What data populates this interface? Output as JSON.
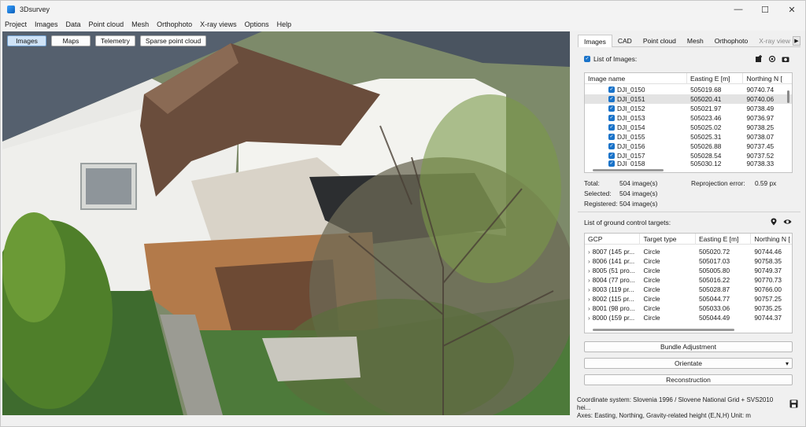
{
  "app": {
    "title": "3Dsurvey"
  },
  "window_controls": {
    "minimize": "—",
    "maximize": "☐",
    "close": "✕"
  },
  "menu": [
    "Project",
    "Images",
    "Data",
    "Point cloud",
    "Mesh",
    "Orthophoto",
    "X-ray views",
    "Options",
    "Help"
  ],
  "view_tabs": [
    {
      "label": "Images",
      "active": true
    },
    {
      "label": "Maps",
      "active": false
    },
    {
      "label": "Telemetry",
      "active": false
    },
    {
      "label": "Sparse point cloud",
      "active": false
    }
  ],
  "panel": {
    "tabs": [
      "Images",
      "CAD",
      "Point cloud",
      "Mesh",
      "Orthophoto",
      "X-ray view"
    ],
    "tab_arrow": "▶",
    "images_list": {
      "label": "List of Images:",
      "icons": [
        "add-image-icon",
        "target-icon",
        "camera-icon"
      ],
      "columns": [
        "Image name",
        "Easting E [m]",
        "Northing N ["
      ],
      "rows": [
        {
          "name": "DJI_0150",
          "easting": "505019.68",
          "northing": "90740.74",
          "selected": false
        },
        {
          "name": "DJI_0151",
          "easting": "505020.41",
          "northing": "90740.06",
          "selected": true
        },
        {
          "name": "DJI_0152",
          "easting": "505021.97",
          "northing": "90738.49",
          "selected": false
        },
        {
          "name": "DJI_0153",
          "easting": "505023.46",
          "northing": "90736.97",
          "selected": false
        },
        {
          "name": "DJI_0154",
          "easting": "505025.02",
          "northing": "90738.25",
          "selected": false
        },
        {
          "name": "DJI_0155",
          "easting": "505025.31",
          "northing": "90738.07",
          "selected": false
        },
        {
          "name": "DJI_0156",
          "easting": "505026.88",
          "northing": "90737.45",
          "selected": false
        },
        {
          "name": "DJI_0157",
          "easting": "505028.54",
          "northing": "90737.52",
          "selected": false
        },
        {
          "name": "DJI_0158",
          "easting": "505030.12",
          "northing": "90738.33",
          "selected": false
        }
      ]
    },
    "stats": {
      "total_label": "Total:",
      "total_value": "504 image(s)",
      "selected_label": "Selected:",
      "selected_value": "504 image(s)",
      "registered_label": "Registered:",
      "registered_value": "504 image(s)",
      "reprojection_label": "Reprojection error:",
      "reprojection_value": "0.59 px"
    },
    "gcp_list": {
      "label": "List of ground control targets:",
      "icons": [
        "map-pin-icon",
        "eye-icon"
      ],
      "columns": [
        "GCP",
        "Target type",
        "Easting E [m]",
        "Northing N ["
      ],
      "rows": [
        {
          "gcp": "8007 (145 pr...",
          "type": "Circle",
          "easting": "505020.72",
          "northing": "90744.46"
        },
        {
          "gcp": "8006 (141 pr...",
          "type": "Circle",
          "easting": "505017.03",
          "northing": "90758.35"
        },
        {
          "gcp": "8005 (51 pro...",
          "type": "Circle",
          "easting": "505005.80",
          "northing": "90749.37"
        },
        {
          "gcp": "8004 (77 pro...",
          "type": "Circle",
          "easting": "505016.22",
          "northing": "90770.73"
        },
        {
          "gcp": "8003 (119 pr...",
          "type": "Circle",
          "easting": "505028.87",
          "northing": "90766.00"
        },
        {
          "gcp": "8002 (115 pr...",
          "type": "Circle",
          "easting": "505044.77",
          "northing": "90757.25"
        },
        {
          "gcp": "8001 (98 pro...",
          "type": "Circle",
          "easting": "505033.06",
          "northing": "90735.25"
        },
        {
          "gcp": "8000 (159 pr...",
          "type": "Circle",
          "easting": "505044.49",
          "northing": "90744.37"
        }
      ]
    },
    "buttons": {
      "bundle": "Bundle Adjustment",
      "orientate": "Orientate",
      "orientate_arrow": "▾",
      "reconstruction": "Reconstruction"
    }
  },
  "footer": {
    "coordinate_system": "Coordinate system: Slovenia 1996 / Slovene National Grid + SVS2010 hei...",
    "axes": "Axes: Easting, Northing, Gravity-related height (E,N,H) Unit: m"
  }
}
